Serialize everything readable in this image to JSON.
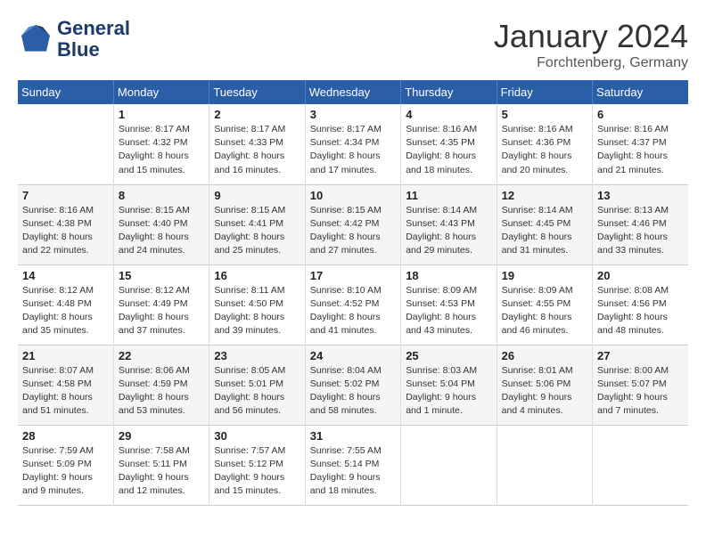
{
  "header": {
    "logo_line1": "General",
    "logo_line2": "Blue",
    "month": "January 2024",
    "location": "Forchtenberg, Germany"
  },
  "weekdays": [
    "Sunday",
    "Monday",
    "Tuesday",
    "Wednesday",
    "Thursday",
    "Friday",
    "Saturday"
  ],
  "weeks": [
    [
      {
        "day": "",
        "content": ""
      },
      {
        "day": "1",
        "content": "Sunrise: 8:17 AM\nSunset: 4:32 PM\nDaylight: 8 hours\nand 15 minutes."
      },
      {
        "day": "2",
        "content": "Sunrise: 8:17 AM\nSunset: 4:33 PM\nDaylight: 8 hours\nand 16 minutes."
      },
      {
        "day": "3",
        "content": "Sunrise: 8:17 AM\nSunset: 4:34 PM\nDaylight: 8 hours\nand 17 minutes."
      },
      {
        "day": "4",
        "content": "Sunrise: 8:16 AM\nSunset: 4:35 PM\nDaylight: 8 hours\nand 18 minutes."
      },
      {
        "day": "5",
        "content": "Sunrise: 8:16 AM\nSunset: 4:36 PM\nDaylight: 8 hours\nand 20 minutes."
      },
      {
        "day": "6",
        "content": "Sunrise: 8:16 AM\nSunset: 4:37 PM\nDaylight: 8 hours\nand 21 minutes."
      }
    ],
    [
      {
        "day": "7",
        "content": "Sunrise: 8:16 AM\nSunset: 4:38 PM\nDaylight: 8 hours\nand 22 minutes."
      },
      {
        "day": "8",
        "content": "Sunrise: 8:15 AM\nSunset: 4:40 PM\nDaylight: 8 hours\nand 24 minutes."
      },
      {
        "day": "9",
        "content": "Sunrise: 8:15 AM\nSunset: 4:41 PM\nDaylight: 8 hours\nand 25 minutes."
      },
      {
        "day": "10",
        "content": "Sunrise: 8:15 AM\nSunset: 4:42 PM\nDaylight: 8 hours\nand 27 minutes."
      },
      {
        "day": "11",
        "content": "Sunrise: 8:14 AM\nSunset: 4:43 PM\nDaylight: 8 hours\nand 29 minutes."
      },
      {
        "day": "12",
        "content": "Sunrise: 8:14 AM\nSunset: 4:45 PM\nDaylight: 8 hours\nand 31 minutes."
      },
      {
        "day": "13",
        "content": "Sunrise: 8:13 AM\nSunset: 4:46 PM\nDaylight: 8 hours\nand 33 minutes."
      }
    ],
    [
      {
        "day": "14",
        "content": "Sunrise: 8:12 AM\nSunset: 4:48 PM\nDaylight: 8 hours\nand 35 minutes."
      },
      {
        "day": "15",
        "content": "Sunrise: 8:12 AM\nSunset: 4:49 PM\nDaylight: 8 hours\nand 37 minutes."
      },
      {
        "day": "16",
        "content": "Sunrise: 8:11 AM\nSunset: 4:50 PM\nDaylight: 8 hours\nand 39 minutes."
      },
      {
        "day": "17",
        "content": "Sunrise: 8:10 AM\nSunset: 4:52 PM\nDaylight: 8 hours\nand 41 minutes."
      },
      {
        "day": "18",
        "content": "Sunrise: 8:09 AM\nSunset: 4:53 PM\nDaylight: 8 hours\nand 43 minutes."
      },
      {
        "day": "19",
        "content": "Sunrise: 8:09 AM\nSunset: 4:55 PM\nDaylight: 8 hours\nand 46 minutes."
      },
      {
        "day": "20",
        "content": "Sunrise: 8:08 AM\nSunset: 4:56 PM\nDaylight: 8 hours\nand 48 minutes."
      }
    ],
    [
      {
        "day": "21",
        "content": "Sunrise: 8:07 AM\nSunset: 4:58 PM\nDaylight: 8 hours\nand 51 minutes."
      },
      {
        "day": "22",
        "content": "Sunrise: 8:06 AM\nSunset: 4:59 PM\nDaylight: 8 hours\nand 53 minutes."
      },
      {
        "day": "23",
        "content": "Sunrise: 8:05 AM\nSunset: 5:01 PM\nDaylight: 8 hours\nand 56 minutes."
      },
      {
        "day": "24",
        "content": "Sunrise: 8:04 AM\nSunset: 5:02 PM\nDaylight: 8 hours\nand 58 minutes."
      },
      {
        "day": "25",
        "content": "Sunrise: 8:03 AM\nSunset: 5:04 PM\nDaylight: 9 hours\nand 1 minute."
      },
      {
        "day": "26",
        "content": "Sunrise: 8:01 AM\nSunset: 5:06 PM\nDaylight: 9 hours\nand 4 minutes."
      },
      {
        "day": "27",
        "content": "Sunrise: 8:00 AM\nSunset: 5:07 PM\nDaylight: 9 hours\nand 7 minutes."
      }
    ],
    [
      {
        "day": "28",
        "content": "Sunrise: 7:59 AM\nSunset: 5:09 PM\nDaylight: 9 hours\nand 9 minutes."
      },
      {
        "day": "29",
        "content": "Sunrise: 7:58 AM\nSunset: 5:11 PM\nDaylight: 9 hours\nand 12 minutes."
      },
      {
        "day": "30",
        "content": "Sunrise: 7:57 AM\nSunset: 5:12 PM\nDaylight: 9 hours\nand 15 minutes."
      },
      {
        "day": "31",
        "content": "Sunrise: 7:55 AM\nSunset: 5:14 PM\nDaylight: 9 hours\nand 18 minutes."
      },
      {
        "day": "",
        "content": ""
      },
      {
        "day": "",
        "content": ""
      },
      {
        "day": "",
        "content": ""
      }
    ]
  ]
}
